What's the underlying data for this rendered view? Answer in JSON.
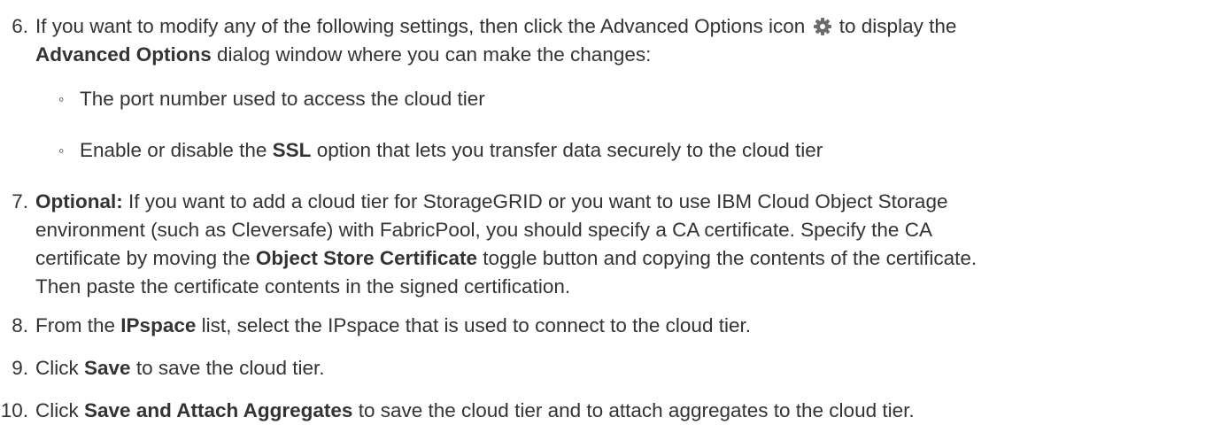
{
  "steps": [
    {
      "number": "6.",
      "line1_pre": "If you want to modify any of the following settings, then click the Advanced Options icon",
      "icon": "gear-icon",
      "line1_post": "to display the",
      "bold1": "Advanced Options",
      "line2_post": "dialog window where you can make the changes:",
      "subitems": [
        {
          "bullet": "◦",
          "text": "The port number used to access the cloud tier"
        },
        {
          "bullet": "◦",
          "pre": "Enable or disable the",
          "bold": "SSL",
          "post": "option that lets you transfer data securely to the cloud tier"
        }
      ]
    },
    {
      "number": "7.",
      "bold_lead": "Optional:",
      "line1": "If you want to add a cloud tier for StorageGRID or you want to use IBM Cloud Object Storage",
      "line2": "environment (such as Cleversafe) with FabricPool, you should specify a CA certificate. Specify the CA",
      "line3_pre": "certificate by moving the",
      "bold": "Object Store Certificate",
      "line3_post": "toggle button and copying the contents of the certificate.",
      "line4": "Then paste the certificate contents in the signed certification."
    },
    {
      "number": "8.",
      "pre": "From the",
      "bold": "IPspace",
      "post": "list, select the IPspace that is used to connect to the cloud tier."
    },
    {
      "number": "9.",
      "pre": "Click",
      "bold": "Save",
      "post": "to save the cloud tier."
    },
    {
      "number": "10.",
      "pre": "Click",
      "bold": "Save and Attach Aggregates",
      "post": "to save the cloud tier and to attach aggregates to the cloud tier."
    }
  ]
}
